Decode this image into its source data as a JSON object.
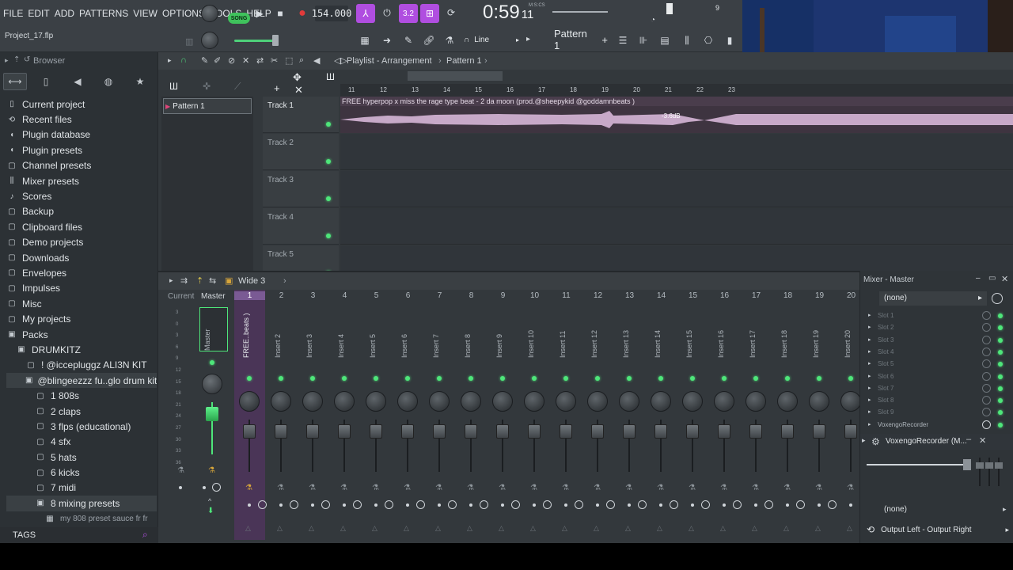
{
  "menu": [
    "FILE",
    "EDIT",
    "ADD",
    "PATTERNS",
    "VIEW",
    "OPTIONS",
    "TOOLS",
    "HELP"
  ],
  "project_name": "Project_17.flp",
  "transport": {
    "mode": "SONG",
    "tempo": "154.000",
    "time_main": "0:59",
    "time_sub": "11",
    "time_caption": "M:S:CS",
    "pattern": "Pattern 1",
    "snap": "Line",
    "step_count": "3.2",
    "cpu_number": "9"
  },
  "browser": {
    "title": "Browser",
    "items": [
      {
        "icon": "page-icon",
        "label": "Current project",
        "level": 0
      },
      {
        "icon": "clock-icon",
        "label": "Recent files",
        "level": 0
      },
      {
        "icon": "plug-icon",
        "label": "Plugin database",
        "level": 0
      },
      {
        "icon": "plug-icon",
        "label": "Plugin presets",
        "level": 0
      },
      {
        "icon": "folder-icon",
        "label": "Channel presets",
        "level": 0
      },
      {
        "icon": "mixer-icon",
        "label": "Mixer presets",
        "level": 0
      },
      {
        "icon": "note-icon",
        "label": "Scores",
        "level": 0
      },
      {
        "icon": "folder-icon",
        "label": "Backup",
        "level": 0
      },
      {
        "icon": "folder-icon",
        "label": "Clipboard files",
        "level": 0
      },
      {
        "icon": "folder-icon",
        "label": "Demo projects",
        "level": 0
      },
      {
        "icon": "folder-icon",
        "label": "Downloads",
        "level": 0
      },
      {
        "icon": "folder-icon",
        "label": "Envelopes",
        "level": 0
      },
      {
        "icon": "folder-icon",
        "label": "Impulses",
        "level": 0
      },
      {
        "icon": "folder-icon",
        "label": "Misc",
        "level": 0
      },
      {
        "icon": "folder-icon",
        "label": "My projects",
        "level": 0
      },
      {
        "icon": "folder-open-icon",
        "label": "Packs",
        "level": 0
      },
      {
        "icon": "folder-open-icon",
        "label": "DRUMKITZ",
        "level": 1
      },
      {
        "icon": "folder-icon",
        "label": "! @iccepluggz ALI3N KIT",
        "level": 2
      },
      {
        "icon": "folder-open-icon",
        "label": "@blingeezzz fu..glo drum kit 2",
        "level": 2
      },
      {
        "icon": "folder-icon",
        "label": "1 808s",
        "level": 3
      },
      {
        "icon": "folder-icon",
        "label": "2 claps",
        "level": 3
      },
      {
        "icon": "folder-icon",
        "label": "3 flps (educational)",
        "level": 3
      },
      {
        "icon": "folder-icon",
        "label": "4 sfx",
        "level": 3
      },
      {
        "icon": "folder-icon",
        "label": "5 hats",
        "level": 3
      },
      {
        "icon": "folder-icon",
        "label": "6 kicks",
        "level": 3
      },
      {
        "icon": "folder-icon",
        "label": "7 midi",
        "level": 3
      },
      {
        "icon": "folder-open-icon",
        "label": "8 mixing presets",
        "level": 3
      },
      {
        "icon": "preset-icon",
        "label": "my 808 preset sauce fr fr",
        "level": 4
      }
    ],
    "tags_label": "TAGS"
  },
  "playlist": {
    "breadcrumb_1": "Playlist - Arrangement",
    "breadcrumb_2": "Pattern 1",
    "pattern_item": "Pattern 1",
    "tracks": [
      "Track 1",
      "Track 2",
      "Track 3",
      "Track 4",
      "Track 5"
    ],
    "ruler": [
      "11",
      "12",
      "13",
      "14",
      "15",
      "16",
      "17",
      "18",
      "19",
      "20",
      "21",
      "22",
      "23"
    ],
    "clip_title": "FREE hyperpop x miss the rage type beat - 2 da moon (prod.@sheepykid @goddamnbeats )",
    "clip_gain": "-3.6dB"
  },
  "mixer": {
    "preset": "Wide 3",
    "current_label": "Current",
    "master_label": "Master",
    "channels": [
      {
        "num": "1",
        "name": "FREE..beats )"
      },
      {
        "num": "2",
        "name": "Insert 2"
      },
      {
        "num": "3",
        "name": "Insert 3"
      },
      {
        "num": "4",
        "name": "Insert 4"
      },
      {
        "num": "5",
        "name": "Insert 5"
      },
      {
        "num": "6",
        "name": "Insert 6"
      },
      {
        "num": "7",
        "name": "Insert 7"
      },
      {
        "num": "8",
        "name": "Insert 8"
      },
      {
        "num": "9",
        "name": "Insert 9"
      },
      {
        "num": "10",
        "name": "Insert 10"
      },
      {
        "num": "11",
        "name": "Insert 11"
      },
      {
        "num": "12",
        "name": "Insert 12"
      },
      {
        "num": "13",
        "name": "Insert 13"
      },
      {
        "num": "14",
        "name": "Insert 14"
      },
      {
        "num": "15",
        "name": "Insert 15"
      },
      {
        "num": "16",
        "name": "Insert 16"
      },
      {
        "num": "17",
        "name": "Insert 17"
      },
      {
        "num": "18",
        "name": "Insert 18"
      },
      {
        "num": "19",
        "name": "Insert 19"
      },
      {
        "num": "20",
        "name": "Insert 20"
      }
    ],
    "scale": [
      "3",
      "0",
      "3",
      "6",
      "9",
      "12",
      "15",
      "18",
      "21",
      "24",
      "27",
      "30",
      "33",
      "36"
    ]
  },
  "mixer_panel": {
    "title": "Mixer - Master",
    "input": "(none)",
    "slots": [
      "Slot 1",
      "Slot 2",
      "Slot 3",
      "Slot 4",
      "Slot 5",
      "Slot 6",
      "Slot 7",
      "Slot 8",
      "Slot 9"
    ],
    "plugin_slot": "VoxengoRecorder",
    "plugin_window": "VoxengoRecorder (M...",
    "output_none": "(none)",
    "output": "Output Left - Output Right"
  },
  "colors": {
    "accent_pink": "#b04ee0",
    "led_green": "#4ee67a",
    "clip_color": "#c7a9c8",
    "webcam_bg": "#203a78"
  }
}
